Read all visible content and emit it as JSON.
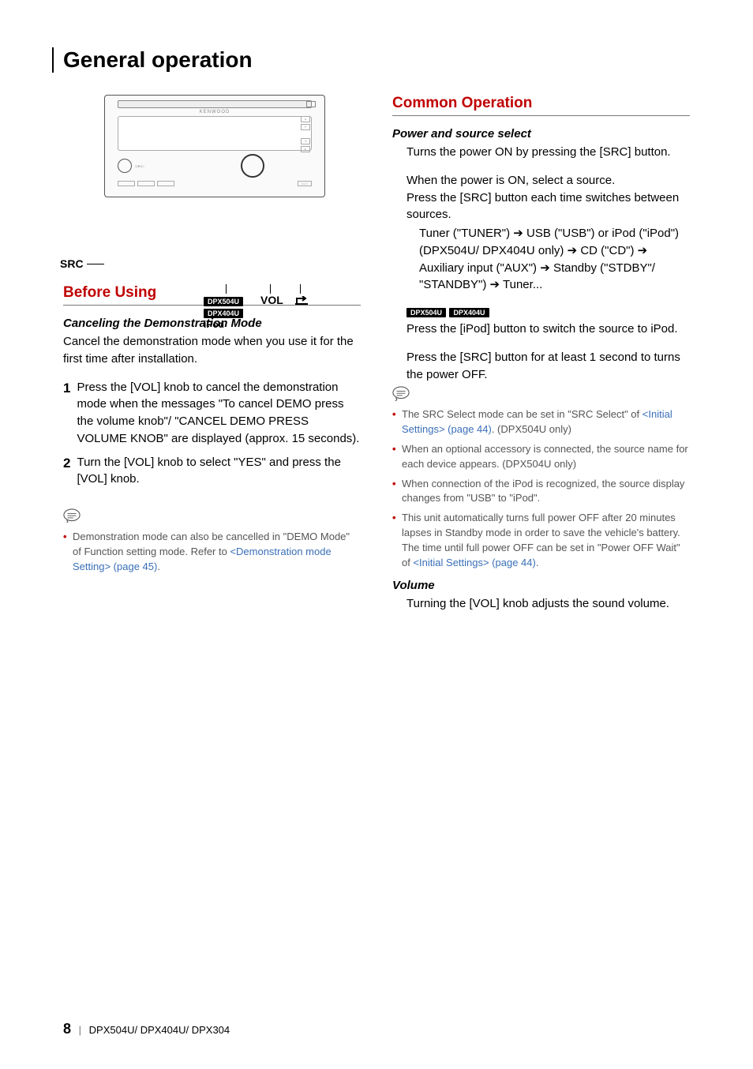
{
  "page_title": "General operation",
  "figure": {
    "src_label": "SRC",
    "vol_label": "VOL",
    "brand": "KENWOOD",
    "aux": "AUX",
    "model_tag_1": "DPX504U",
    "model_tag_2": "DPX404U",
    "ipod_label": "iPod"
  },
  "left": {
    "section": "Before Using",
    "sub": "Canceling the Demonstration Mode",
    "intro": "Cancel the demonstration mode when you use it for the first time after installation.",
    "steps": [
      "Press the [VOL] knob to cancel the demonstration mode when the messages \"To cancel DEMO press the volume knob\"/ \"CANCEL DEMO PRESS VOLUME KNOB\" are displayed (approx. 15 seconds).",
      "Turn the [VOL] knob to select \"YES\" and press the [VOL] knob."
    ],
    "note_prefix": "Demonstration mode can also be cancelled in \"DEMO Mode\" of Function setting mode. Refer to ",
    "note_link": "<Demonstration mode Setting> (page 45)",
    "note_suffix": "."
  },
  "right": {
    "section": "Common Operation",
    "power": {
      "heading": "Power and source select",
      "p1": "Turns the power ON by pressing the [SRC] button.",
      "p2": "When the power is ON, select a source.\nPress the [SRC] button each time switches between sources.",
      "seq_1": "Tuner (\"TUNER\") ",
      "seq_2": " USB (\"USB\") or iPod (\"iPod\") (DPX504U/ DPX404U only) ",
      "seq_3": " CD (\"CD\") ",
      "seq_4": " Auxiliary input (\"AUX\") ",
      "seq_5": " Standby (\"STDBY\"/ \"STANDBY\") ",
      "seq_6": " Tuner...",
      "badge1": "DPX504U",
      "badge2": "DPX404U",
      "p3": "Press the [iPod] button to switch the source to iPod.",
      "p4": "Press the [SRC] button for at least 1 second to turns the power OFF.",
      "notes": {
        "n1_a": "The SRC Select mode can be set in \"SRC Select\" of ",
        "n1_link": "<Initial Settings> (page 44)",
        "n1_b": ". (DPX504U only)",
        "n2": "When an optional accessory is connected, the source name for each device appears. (DPX504U only)",
        "n3": "When connection of the iPod is recognized, the source display changes from \"USB\" to \"iPod\".",
        "n4_a": "This unit automatically turns full power OFF after 20 minutes lapses in Standby mode in order to save the vehicle's battery. The time until full power OFF can be set in \"Power OFF Wait\" of ",
        "n4_link": "<Initial Settings> (page 44)",
        "n4_b": "."
      }
    },
    "volume": {
      "heading": "Volume",
      "body": "Turning the [VOL] knob adjusts the sound volume."
    }
  },
  "footer": {
    "page_num": "8",
    "models": "DPX504U/ DPX404U/ DPX304"
  }
}
